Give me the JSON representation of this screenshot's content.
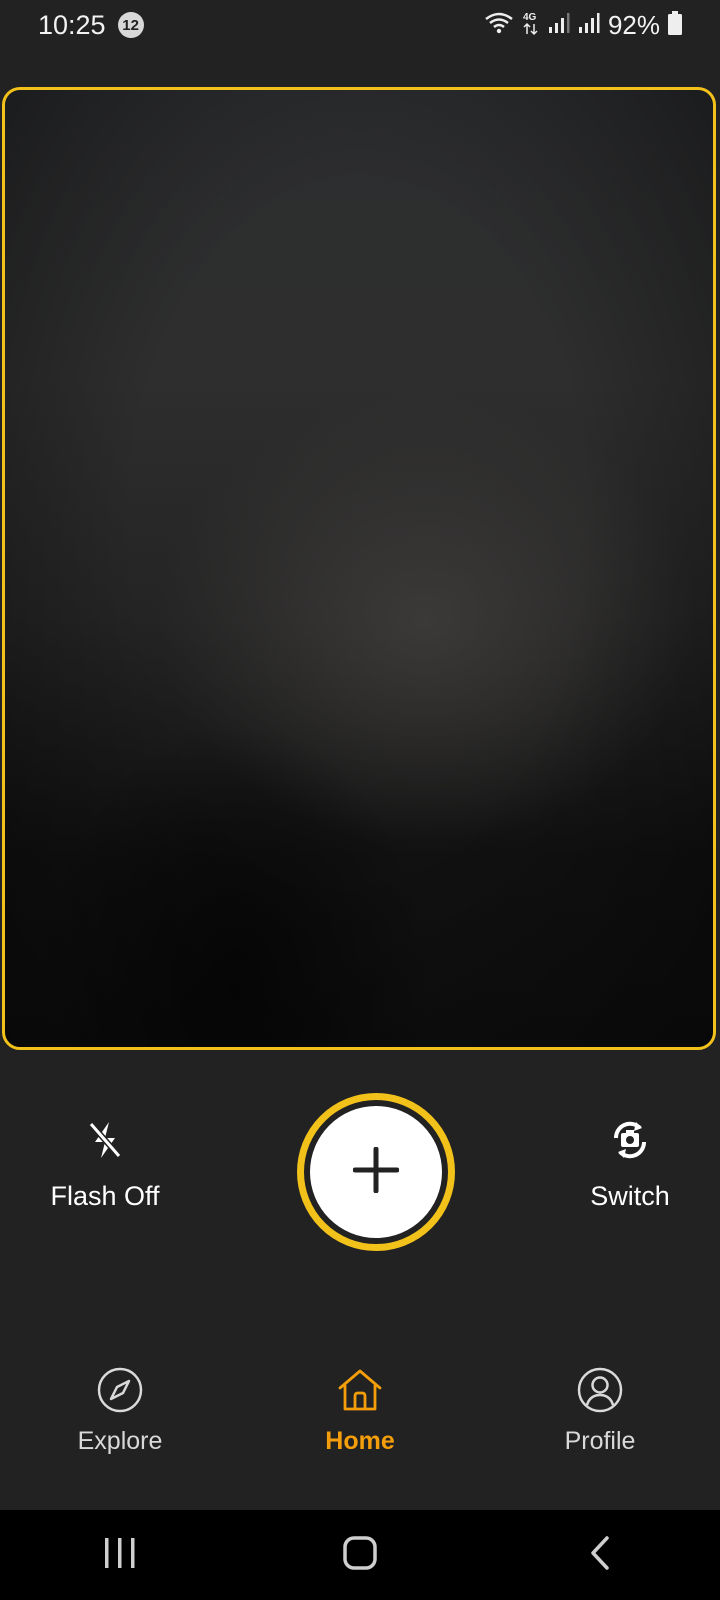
{
  "status_bar": {
    "time": "10:25",
    "notification_count": "12",
    "battery": "92%"
  },
  "controls": {
    "flash_label": "Flash Off",
    "switch_label": "Switch",
    "capture_icon": "plus-icon"
  },
  "bottom_nav": {
    "items": [
      {
        "label": "Explore",
        "icon": "compass-icon",
        "active": false
      },
      {
        "label": "Home",
        "icon": "home-icon",
        "active": true
      },
      {
        "label": "Profile",
        "icon": "profile-icon",
        "active": false
      }
    ]
  },
  "colors": {
    "accent": "#f2c21b",
    "active_nav": "#f59e0b",
    "background": "#222222"
  }
}
